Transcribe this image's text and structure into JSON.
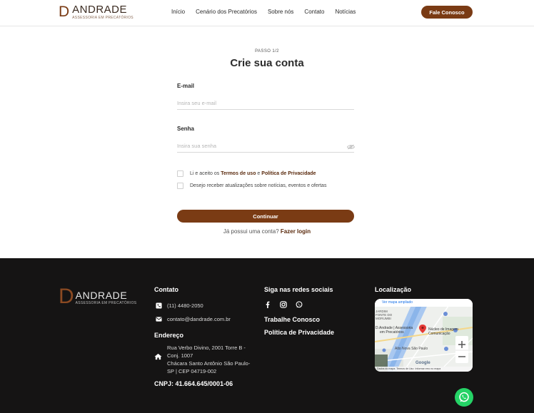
{
  "header": {
    "logo_letter": "D",
    "logo_name": "ANDRADE",
    "logo_sub": "ASSESSORIA EM PRECATÓRIOS",
    "nav": [
      "Início",
      "Cenário dos Precatórios",
      "Sobre nós",
      "Contato",
      "Notícias"
    ],
    "cta": "Fale Conosco"
  },
  "form": {
    "step": "PASSO 1/2",
    "title": "Crie sua conta",
    "email_label": "E-mail",
    "email_placeholder": "Insira seu e-mail",
    "email_value": "",
    "password_label": "Senha",
    "password_placeholder": "Insira sua senha",
    "password_value": "",
    "terms_prefix": "Li e aceito os ",
    "terms_link": "Termos de uso",
    "terms_mid": " e ",
    "privacy_link": "Política de Privacidade",
    "newsletter": "Desejo receber atualizações sobre notícias, eventos e ofertas",
    "continue": "Continuar",
    "login_prefix": "Já possui uma conta?",
    "login_link": "Fazer login"
  },
  "footer": {
    "logo_letter": "D",
    "logo_name": "ANDRADE",
    "logo_sub": "ASSESSORIA EM PRECATÓRIOS",
    "contact_heading": "Contato",
    "phone": "(11) 4480-2050",
    "email": "contato@dandrade.com.br",
    "address_heading": "Endereço",
    "address_lines": [
      "Rua Verbo Divino, 2001 Torre B -",
      "Conj. 1007",
      "Chácara Santo Antônio São Paulo-",
      "SP | CEP 04719-002"
    ],
    "cnpj": "CNPJ: 41.664.645/0001-06",
    "social_heading": "Siga nas redes sociais",
    "work_with_us": "Trabalhe Conosco",
    "privacy_policy": "Política de Privacidade",
    "location_heading": "Localização",
    "map": {
      "view_larger": "Ver mapa ampliado",
      "place1": "D.Andrade | Assessoria",
      "place1b": "em Precatórios",
      "place2": "Núcleo de Imagem",
      "place2b": "Comunicação",
      "street": "Alto Nova São Paulo",
      "area": "JARDIM FONTE DO MORUMBI",
      "provider": "Google",
      "credits": "Dados do mapa  Termos de Uso  Informar erro no mapa"
    }
  },
  "colors": {
    "brand": "#7a3b14",
    "footer_bg": "#151414",
    "whatsapp": "#25d366"
  }
}
